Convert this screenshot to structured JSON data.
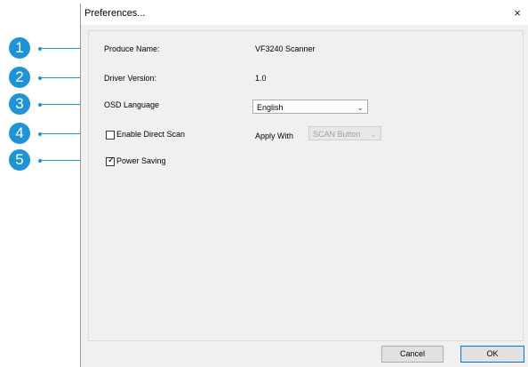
{
  "window": {
    "title": "Preferences...",
    "close_glyph": "×"
  },
  "fields": {
    "produce_name_label": "Produce Name:",
    "produce_name_value": "VF3240 Scanner",
    "driver_version_label": "Driver Version:",
    "driver_version_value": "1.0",
    "osd_language_label": "OSD Language",
    "osd_language_value": "English",
    "enable_direct_scan_label": "Enable Direct Scan",
    "enable_direct_scan_checked": false,
    "apply_with_label": "Apply With",
    "apply_with_value": "SCAN Button",
    "power_saving_label": "Power Saving",
    "power_saving_checked": true,
    "check_glyph": "✓",
    "chevron_glyph": "⌄"
  },
  "buttons": {
    "cancel": "Cancel",
    "ok": "OK"
  },
  "callouts": [
    "1",
    "2",
    "3",
    "4",
    "5"
  ],
  "colors": {
    "callout": "#1c94d6",
    "window_bg": "#f0f0f0",
    "default_button_border": "#0078d7"
  }
}
